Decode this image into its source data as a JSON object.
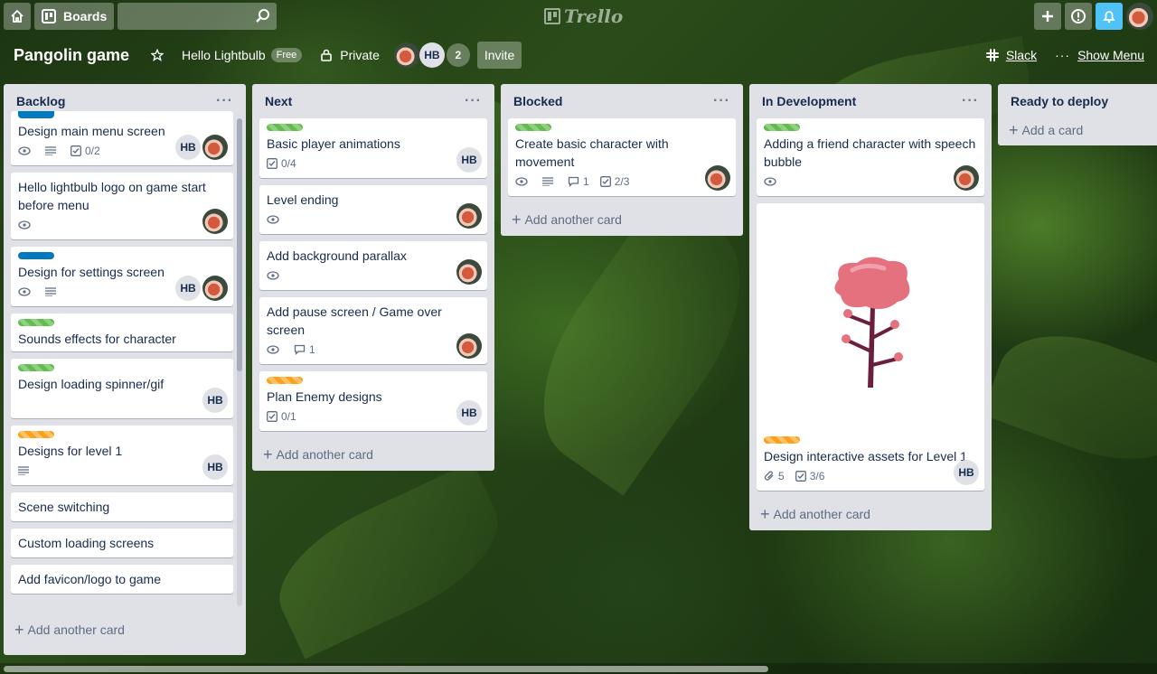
{
  "topbar": {
    "home_icon": "home-icon",
    "boards_label": "Boards",
    "search_placeholder": "",
    "logo_text": "Trello",
    "icons": [
      "plus-icon",
      "info-icon",
      "bell-icon"
    ]
  },
  "board": {
    "name": "Pangolin game",
    "team": "Hello Lightbulb",
    "team_badge": "Free",
    "visibility": "Private",
    "member_initials": "HB",
    "member_count": "2",
    "invite_label": "Invite",
    "slack_label": "Slack",
    "show_menu_label": "Show Menu"
  },
  "lists": [
    {
      "title": "Backlog",
      "add_label": "Add another card",
      "cards": [
        {
          "label": "blue",
          "title": "Design main menu screen",
          "badges": {
            "watch": true,
            "desc": true,
            "checklist": "0/2"
          },
          "members": [
            "HB",
            "photo"
          ]
        },
        {
          "label": "",
          "title": "Hello lightbulb logo on game start before menu",
          "badges": {
            "watch": true
          },
          "members": [
            "photo"
          ]
        },
        {
          "label": "blue",
          "title": "Design for settings screen",
          "badges": {
            "watch": true,
            "desc": true
          },
          "members": [
            "HB",
            "photo"
          ]
        },
        {
          "label": "green",
          "title": "Sounds effects for character",
          "badges": {},
          "members": []
        },
        {
          "label": "green",
          "title": "Design loading spinner/gif",
          "badges": {},
          "members": [
            "HB"
          ]
        },
        {
          "label": "orange",
          "title": "Designs for level 1",
          "badges": {
            "desc": true
          },
          "members": [
            "HB"
          ]
        },
        {
          "label": "",
          "title": "Scene switching",
          "badges": {},
          "members": []
        },
        {
          "label": "",
          "title": "Custom loading screens",
          "badges": {},
          "members": []
        },
        {
          "label": "",
          "title": "Add favicon/logo to game",
          "badges": {},
          "members": []
        }
      ]
    },
    {
      "title": "Next",
      "add_label": "Add another card",
      "cards": [
        {
          "label": "green",
          "title": "Basic player animations",
          "badges": {
            "checklist": "0/4"
          },
          "members": [
            "HB"
          ]
        },
        {
          "label": "",
          "title": "Level ending",
          "badges": {
            "watch": true
          },
          "members": [
            "photo"
          ]
        },
        {
          "label": "",
          "title": "Add background parallax",
          "badges": {
            "watch": true
          },
          "members": [
            "photo"
          ]
        },
        {
          "label": "",
          "title": "Add pause screen / Game over screen",
          "badges": {
            "watch": true,
            "comments": "1"
          },
          "members": [
            "photo"
          ]
        },
        {
          "label": "orange",
          "title": "Plan Enemy designs",
          "badges": {
            "checklist": "0/1"
          },
          "members": [
            "HB"
          ]
        }
      ]
    },
    {
      "title": "Blocked",
      "add_label": "Add another card",
      "cards": [
        {
          "label": "green",
          "title": "Create basic character with movement",
          "badges": {
            "watch": true,
            "desc": true,
            "comments": "1",
            "checklist": "2/3"
          },
          "members": [
            "photo"
          ]
        }
      ]
    },
    {
      "title": "In Development",
      "add_label": "Add another card",
      "cards": [
        {
          "label": "green",
          "title": "Adding a friend character with speech bubble",
          "badges": {
            "watch": true
          },
          "members": [
            "photo"
          ]
        },
        {
          "label": "orange",
          "title": "Design interactive assets for Level 1",
          "cover": "tree-illustration",
          "badges": {
            "attachments": "5",
            "checklist": "3/6"
          },
          "members": [
            "HB"
          ]
        }
      ]
    },
    {
      "title": "Ready to deploy",
      "add_label": "Add a card",
      "cards": []
    }
  ],
  "colors": {
    "label_green": "#61bd4f",
    "label_blue": "#0079bf",
    "label_orange": "#ff9f1a",
    "notification": "#4fc3f7"
  }
}
